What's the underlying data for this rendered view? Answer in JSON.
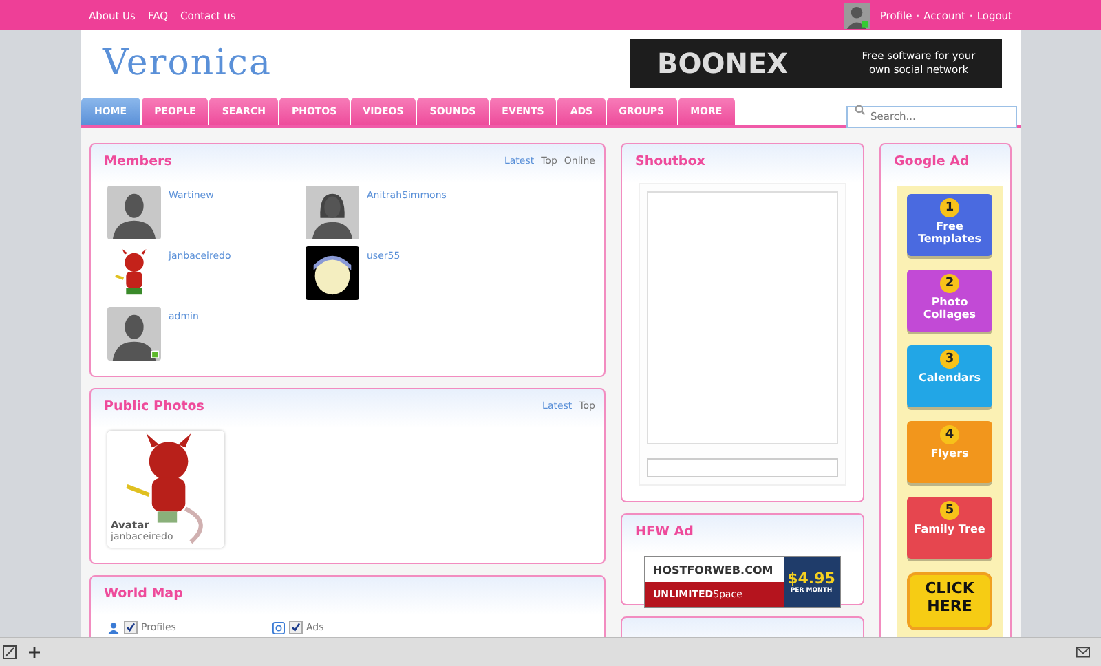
{
  "top_bar": {
    "links": [
      "About Us",
      "FAQ",
      "Contact us"
    ],
    "user_links": [
      "Profile",
      "Account",
      "Logout"
    ],
    "separator": "·"
  },
  "header": {
    "logo": "Veronica",
    "banner": {
      "brand": "BOONEX",
      "tagline": "Free software for your own social network"
    }
  },
  "nav": {
    "tabs": [
      {
        "label": "HOME",
        "selected": true
      },
      {
        "label": "PEOPLE",
        "selected": false
      },
      {
        "label": "SEARCH",
        "selected": false
      },
      {
        "label": "PHOTOS",
        "selected": false
      },
      {
        "label": "VIDEOS",
        "selected": false
      },
      {
        "label": "SOUNDS",
        "selected": false
      },
      {
        "label": "EVENTS",
        "selected": false
      },
      {
        "label": "ADS",
        "selected": false
      },
      {
        "label": "GROUPS",
        "selected": false
      },
      {
        "label": "MORE",
        "selected": false
      }
    ],
    "search": {
      "placeholder": "Search..."
    }
  },
  "members": {
    "title": "Members",
    "tabs": [
      {
        "label": "Latest",
        "selected": true
      },
      {
        "label": "Top",
        "selected": false
      },
      {
        "label": "Online",
        "selected": false
      }
    ],
    "items": [
      {
        "name": "Wartinew",
        "kind": "male",
        "online": false
      },
      {
        "name": "AnitrahSimmons",
        "kind": "female",
        "online": false
      },
      {
        "name": "janbaceiredo",
        "kind": "figure",
        "online": false
      },
      {
        "name": "user55",
        "kind": "face",
        "online": false
      },
      {
        "name": "admin",
        "kind": "male",
        "online": true
      }
    ]
  },
  "public_photos": {
    "title": "Public Photos",
    "tabs": [
      {
        "label": "Latest",
        "selected": true
      },
      {
        "label": "Top",
        "selected": false
      }
    ],
    "photos": [
      {
        "title": "Avatar",
        "author": "janbaceiredo",
        "kind": "picture"
      }
    ]
  },
  "world_map": {
    "title": "World Map",
    "filters": [
      {
        "label": "Profiles",
        "checked": true,
        "kind": "person"
      },
      {
        "label": "Ads",
        "checked": true,
        "kind": "at"
      }
    ]
  },
  "shoutbox": {
    "title": "Shoutbox"
  },
  "hfw_ad": {
    "title": "HFW Ad",
    "brand": "HOSTFORWEB.COM",
    "price": "$4.95",
    "period": "PER MONTH",
    "strong": "UNLIMITED",
    "light": "Space"
  },
  "google_ad": {
    "title": "Google Ad",
    "items": [
      {
        "number": "1",
        "label": "Free Templates",
        "color": "#4a6ae0"
      },
      {
        "number": "2",
        "label": "Photo Collages",
        "color": "#c24ad6"
      },
      {
        "number": "3",
        "label": "Calendars",
        "color": "#22a6e6"
      },
      {
        "number": "4",
        "label": "Flyers",
        "color": "#f2961c"
      },
      {
        "number": "5",
        "label": "Family Tree",
        "color": "#e6464f"
      }
    ],
    "cta": "CLICK HERE"
  }
}
